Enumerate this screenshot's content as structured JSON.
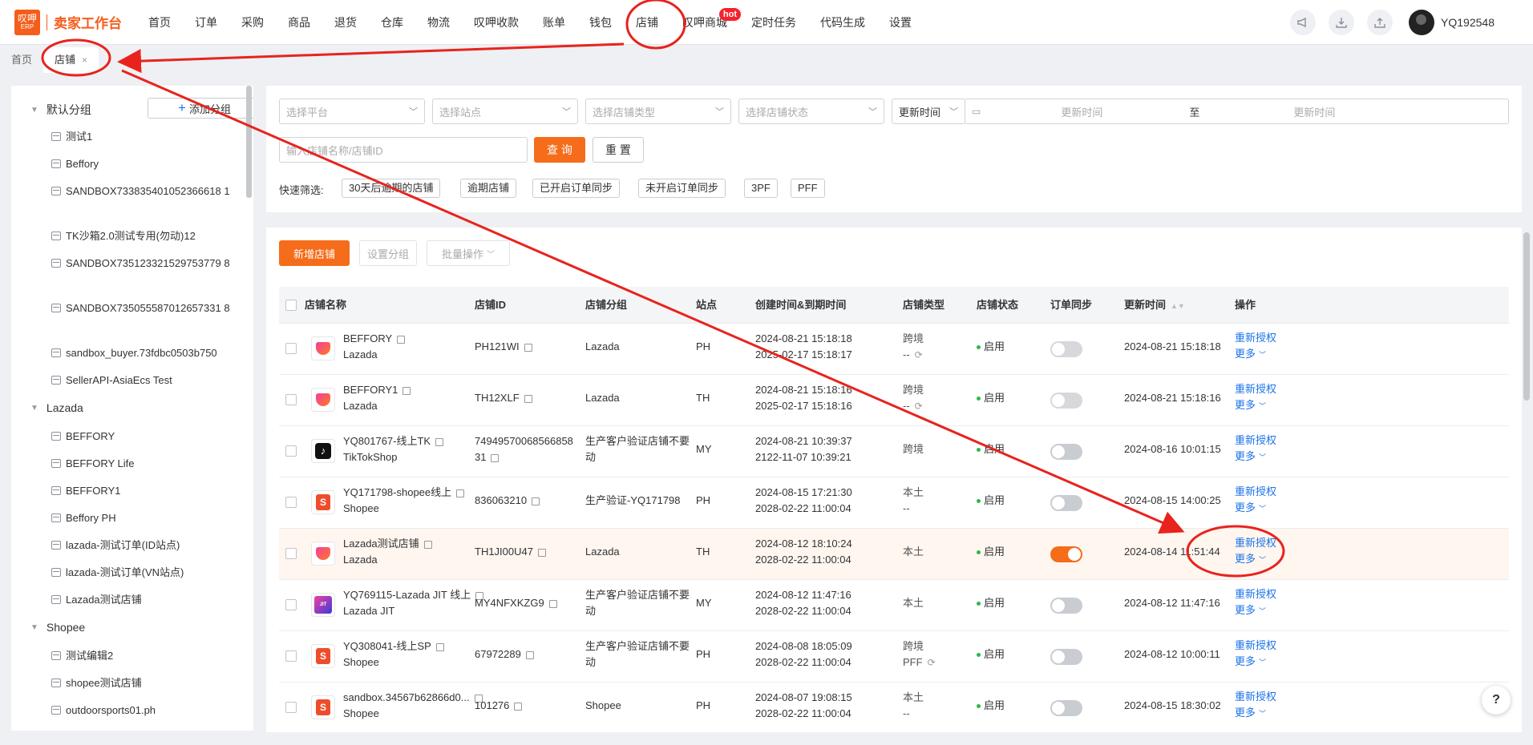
{
  "app": {
    "logo_top": "叹呷",
    "logo_bottom": "ERP",
    "title": "卖家工作台"
  },
  "nav": [
    "首页",
    "订单",
    "采购",
    "商品",
    "退货",
    "仓库",
    "物流",
    "叹呷收款",
    "账单",
    "钱包",
    "店铺",
    "叹呷商城",
    "定时任务",
    "代码生成",
    "设置"
  ],
  "nav_badge": "hot",
  "user": {
    "name": "YQ192548"
  },
  "tabs": {
    "home": "首页",
    "current": "店铺",
    "close": "×"
  },
  "sidebar": {
    "add_group": "添加分组",
    "groups": [
      {
        "name": "默认分组",
        "items": [
          "测试1",
          "Beffory",
          "SANDBOX733835401052366618 1",
          "TK沙箱2.0测试专用(勿动)12",
          "SANDBOX735123321529753779 8",
          "SANDBOX735055587012657331 8",
          "sandbox_buyer.73fdbc0503b750",
          "SellerAPI-AsiaEcs Test"
        ]
      },
      {
        "name": "Lazada",
        "items": [
          "BEFFORY",
          "BEFFORY Life",
          "BEFFORY1",
          "Beffory PH",
          "lazada-测试订单(ID站点)",
          "lazada-测试订单(VN站点)",
          "Lazada测试店铺"
        ]
      },
      {
        "name": "Shopee",
        "items": [
          "测试编辑2",
          "shopee测试店铺",
          "outdoorsports01.ph"
        ]
      }
    ]
  },
  "filters": {
    "platform": "选择平台",
    "site": "选择站点",
    "store_type": "选择店铺类型",
    "store_status": "选择店铺状态",
    "time_type": "更新时间",
    "time_start": "更新时间",
    "time_to": "至",
    "time_end": "更新时间",
    "search_placeholder": "输入店铺名称/店铺ID",
    "query": "查 询",
    "reset": "重 置",
    "quick_label": "快速筛选:",
    "quick": [
      "30天后逾期的店铺",
      "逾期店铺",
      "已开启订单同步",
      "未开启订单同步",
      "3PF",
      "PFF"
    ]
  },
  "toolbar": {
    "new_store": "新增店铺",
    "set_group": "设置分组",
    "batch": "批量操作"
  },
  "columns": [
    "店铺名称",
    "店铺ID",
    "店铺分组",
    "站点",
    "创建时间&到期时间",
    "店铺类型",
    "店铺状态",
    "订单同步",
    "更新时间",
    "操作"
  ],
  "rows": [
    {
      "logo": "lazada",
      "name": "BEFFORY",
      "platform": "Lazada",
      "id": "PH121WI",
      "id2": "",
      "group": "Lazada",
      "group2": "",
      "site": "PH",
      "created": "2024-08-21 15:18:18",
      "expires": "2025-02-17 15:18:17",
      "type": "跨境",
      "type2": "--",
      "status": "启用",
      "sync": "off",
      "updated": "2024-08-21 15:18:18"
    },
    {
      "logo": "lazada",
      "name": "BEFFORY1",
      "platform": "Lazada",
      "id": "TH12XLF",
      "id2": "",
      "group": "Lazada",
      "group2": "",
      "site": "TH",
      "created": "2024-08-21 15:18:16",
      "expires": "2025-02-17 15:18:16",
      "type": "跨境",
      "type2": "--",
      "status": "启用",
      "sync": "off",
      "updated": "2024-08-21 15:18:16"
    },
    {
      "logo": "tiktok",
      "name": "YQ801767-线上TK",
      "platform": "TikTokShop",
      "id": "7494957006856685831",
      "id2": "",
      "group": "生产客户验证店铺不要",
      "group2": "动",
      "site": "MY",
      "created": "2024-08-21 10:39:37",
      "expires": "2122-11-07 10:39:21",
      "type": "跨境",
      "type2": "",
      "status": "启用",
      "sync": "off-dark",
      "updated": "2024-08-16 10:01:15"
    },
    {
      "logo": "shopee",
      "name": "YQ171798-shopee线上",
      "platform": "Shopee",
      "id": "836063210",
      "id2": "",
      "group": "生产验证-YQ171798",
      "group2": "",
      "site": "PH",
      "created": "2024-08-15 17:21:30",
      "expires": "2028-02-22 11:00:04",
      "type": "本土",
      "type2": "--",
      "status": "启用",
      "sync": "off-dark",
      "updated": "2024-08-15 14:00:25"
    },
    {
      "logo": "lazada",
      "name": "Lazada测试店铺",
      "platform": "Lazada",
      "id": "TH1JI00U47",
      "id2": "",
      "group": "Lazada",
      "group2": "",
      "site": "TH",
      "created": "2024-08-12 18:10:24",
      "expires": "2028-02-22 11:00:04",
      "type": "本土",
      "type2": "",
      "status": "启用",
      "sync": "on",
      "updated": "2024-08-14 11:51:44"
    },
    {
      "logo": "jit",
      "name": "YQ769115-Lazada JIT 线上",
      "platform": "Lazada JIT",
      "id": "MY4NFXKZG9",
      "id2": "",
      "group": "生产客户验证店铺不要",
      "group2": "动",
      "site": "MY",
      "created": "2024-08-12 11:47:16",
      "expires": "2028-02-22 11:00:04",
      "type": "本土",
      "type2": "",
      "status": "启用",
      "sync": "off-dark",
      "updated": "2024-08-12 11:47:16"
    },
    {
      "logo": "shopee",
      "name": "YQ308041-线上SP",
      "platform": "Shopee",
      "id": "67972289",
      "id2": "",
      "group": "生产客户验证店铺不要",
      "group2": "动",
      "site": "PH",
      "created": "2024-08-08 18:05:09",
      "expires": "2028-02-22 11:00:04",
      "type": "跨境",
      "type2": "PFF",
      "status": "启用",
      "sync": "off-dark",
      "updated": "2024-08-12 10:00:11"
    },
    {
      "logo": "shopee",
      "name": "sandbox.34567b62866d0...",
      "platform": "Shopee",
      "id": "101276",
      "id2": "",
      "group": "Shopee",
      "group2": "",
      "site": "PH",
      "created": "2024-08-07 19:08:15",
      "expires": "2028-02-22 11:00:04",
      "type": "本土",
      "type2": "--",
      "status": "启用",
      "sync": "off-dark",
      "updated": "2024-08-15 18:30:02"
    }
  ],
  "actions": {
    "reauth": "重新授权",
    "more": "更多"
  },
  "help": "?",
  "annotation_color": "#e8231d",
  "accent": "#f56c1a"
}
